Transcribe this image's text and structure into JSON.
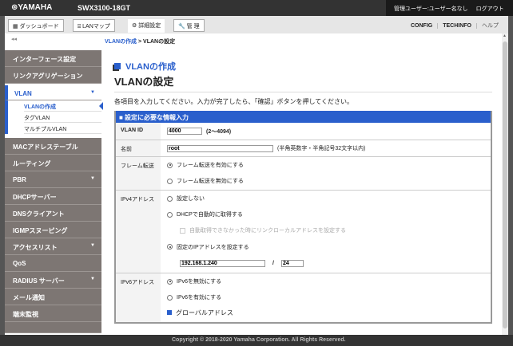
{
  "header": {
    "logo": "⊛YAMAHA",
    "model": "SWX3100-18GT",
    "user": "管理ユーザー:ユーザー名なし",
    "logout": "ログアウト"
  },
  "nav": {
    "tabs": [
      {
        "icon": "▦",
        "label": "ダッシュボード"
      },
      {
        "icon": "⌸",
        "label": "LANマップ"
      },
      {
        "icon": "⚙",
        "label": "詳細設定"
      },
      {
        "icon": "🔧",
        "label": "管 理"
      }
    ],
    "config": "CONFIG",
    "techinfo": "TECHINFO",
    "help": "ヘルプ"
  },
  "collapse": "◂◂",
  "breadcrumb": {
    "parent": "VLANの作成",
    "sep": " > ",
    "current": "VLANの設定"
  },
  "sidebar": {
    "items": [
      "インターフェース設定",
      "リンクアグリゲーション"
    ],
    "open": "VLAN",
    "sub": [
      "VLANの作成",
      "タグVLAN",
      "マルチプルVLAN"
    ],
    "items2": [
      {
        "label": "MACアドレステーブル"
      },
      {
        "label": "ルーティング"
      },
      {
        "label": "PBR",
        "arrow": "▼"
      },
      {
        "label": "DHCPサーバー"
      },
      {
        "label": "DNSクライアント"
      },
      {
        "label": "IGMPスヌーピング"
      },
      {
        "label": "アクセスリスト",
        "arrow": "▼"
      },
      {
        "label": "QoS"
      },
      {
        "label": "RADIUS サーバー",
        "arrow": "▼"
      },
      {
        "label": "メール通知"
      },
      {
        "label": "端末監視"
      }
    ],
    "arrow": "▼"
  },
  "main": {
    "title": "VLANの作成",
    "subtitle": "VLANの設定",
    "desc": "各項目を入力してください。入力が完了したら、「確認」ボタンを押してください。",
    "form": {
      "header": "■ 設定に必要な情報入力",
      "vlan_id": {
        "label": "VLAN ID",
        "value": "4000",
        "hint": "(2〜4094)"
      },
      "name": {
        "label": "名前",
        "value": "root",
        "hint": "(半角英数字・半角記号32文字以内)"
      },
      "frame": {
        "label": "フレーム転送",
        "opt1": "フレーム転送を有効にする",
        "opt2": "フレーム転送を無効にする"
      },
      "ipv4": {
        "label": "IPv4アドレス",
        "opt1": "設定しない",
        "opt2": "DHCPで自動的に取得する",
        "chk": "自動取得できなかった時にリンクローカルアドレスを設定する",
        "opt3": "固定のIPアドレスを設定する",
        "ip": "192.168.1.240",
        "slash": "/",
        "mask": "24"
      },
      "ipv6": {
        "label": "IPv6アドレス",
        "opt1": "IPv6を無効にする",
        "opt2": "IPv6を有効にする",
        "global": "グローバルアドレス"
      }
    }
  },
  "footer": "Copyright © 2018-2020 Yamaha Corporation. All Rights Reserved."
}
